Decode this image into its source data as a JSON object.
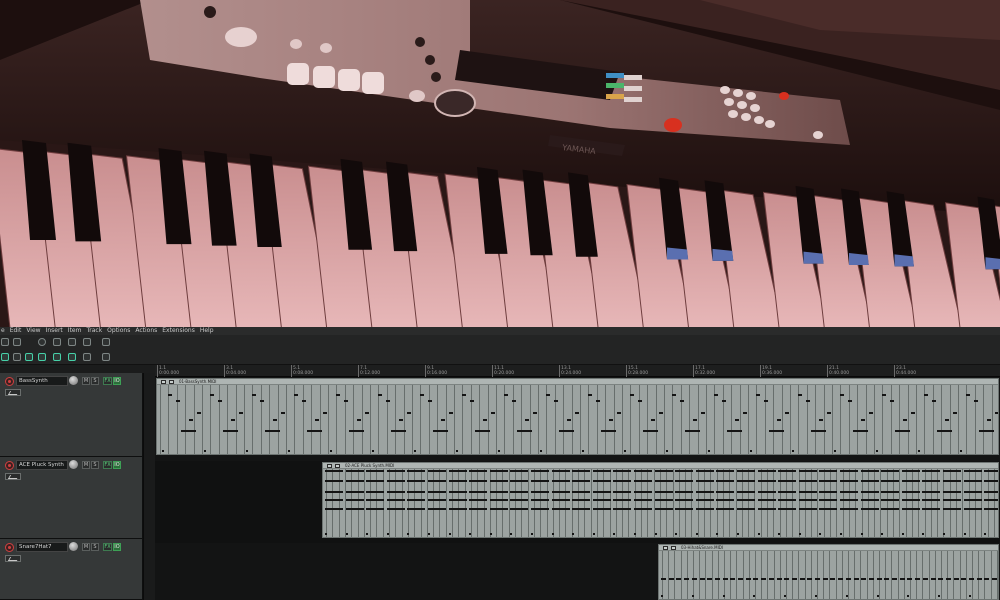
{
  "menu": [
    "e",
    "Edit",
    "View",
    "Insert",
    "Item",
    "Track",
    "Options",
    "Actions",
    "Extensions",
    "Help"
  ],
  "ruler": {
    "labels": [
      {
        "bar": "1.1",
        "time": "0:00.000"
      },
      {
        "bar": "3.1",
        "time": "0:04.000"
      },
      {
        "bar": "5.1",
        "time": "0:08.000"
      },
      {
        "bar": "7.1",
        "time": "0:12.000"
      },
      {
        "bar": "9.1",
        "time": "0:16.000"
      },
      {
        "bar": "11.1",
        "time": "0:20.000"
      },
      {
        "bar": "13.1",
        "time": "0:24.000"
      },
      {
        "bar": "15.1",
        "time": "0:28.000"
      },
      {
        "bar": "17.1",
        "time": "0:32.000"
      },
      {
        "bar": "19.1",
        "time": "0:36.000"
      },
      {
        "bar": "21.1",
        "time": "0:40.000"
      },
      {
        "bar": "23.1",
        "time": "0:44.000"
      }
    ]
  },
  "tracks": [
    {
      "name": "BassSynth",
      "mute_label": "M",
      "solo_label": "S",
      "fx_label": "FX",
      "io_label": "IO"
    },
    {
      "name": "ACE Pluck Synth",
      "mute_label": "M",
      "solo_label": "S",
      "fx_label": "FX",
      "io_label": "IO"
    },
    {
      "name": "Snare7Hat7",
      "mute_label": "M",
      "solo_label": "S",
      "fx_label": "FX",
      "io_label": "IO"
    }
  ],
  "items": [
    {
      "label": "01-BassSynth.MIDI",
      "track": 0
    },
    {
      "label": "02-ACE Pluck Synth.MIDI",
      "track": 1
    },
    {
      "label": "03-Hihat&Snare.MIDI",
      "track": 2
    }
  ],
  "photo": {
    "brand_text": "YAMAHA"
  },
  "colors": {
    "accent": "#47d0a8",
    "record": "#d04040",
    "item_bg": "#9ca3a1",
    "track_panel": "#353838"
  }
}
